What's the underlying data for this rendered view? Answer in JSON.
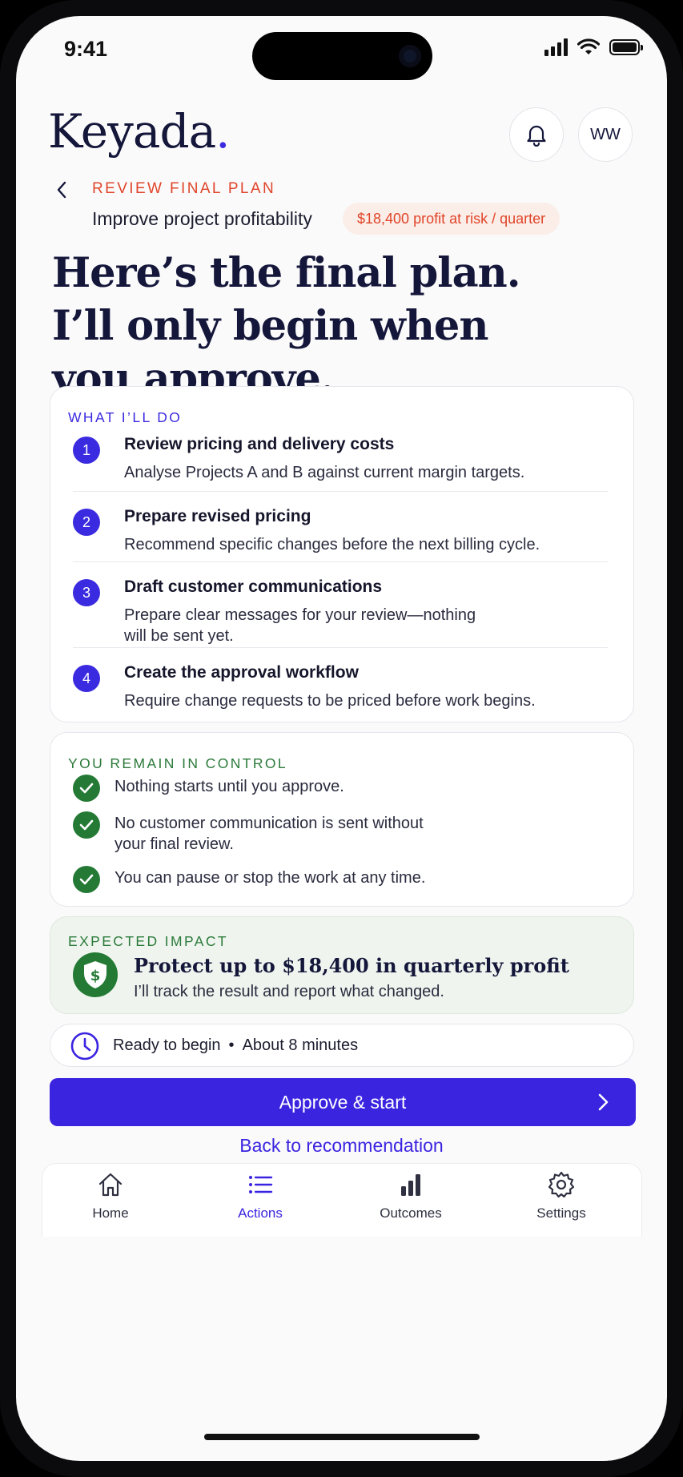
{
  "status": {
    "time": "9:41"
  },
  "header": {
    "brand": "Keyada",
    "brand_dot": ".",
    "avatar_initials": "WW"
  },
  "breadcrumb": {
    "label": "REVIEW FINAL PLAN",
    "subtitle": "Improve project profitability",
    "risk_badge": "$18,400 profit at risk / quarter"
  },
  "headline": {
    "line1": "Here’s the final plan.",
    "line2": "I’ll only begin when",
    "line3": "you approve."
  },
  "plan": {
    "label": "WHAT I’LL DO",
    "steps": [
      {
        "num": "1",
        "title": "Review pricing and delivery costs",
        "desc": "Analyse Projects A and B against current margin targets."
      },
      {
        "num": "2",
        "title": "Prepare revised pricing",
        "desc": "Recommend specific changes before the next billing cycle."
      },
      {
        "num": "3",
        "title": "Draft customer communications",
        "desc": "Prepare clear messages for your review—nothing will be sent yet."
      },
      {
        "num": "4",
        "title": "Create the approval workflow",
        "desc": "Require change requests to be priced before work begins."
      }
    ]
  },
  "control": {
    "label": "YOU REMAIN IN CONTROL",
    "items": [
      "Nothing starts until you approve.",
      "No customer communication is sent without your final review.",
      "You can pause or stop the work at any time."
    ]
  },
  "impact": {
    "label": "EXPECTED IMPACT",
    "title": "Protect up to $18,400 in quarterly profit",
    "sub": "I’ll track the result and report what changed."
  },
  "ready": {
    "status": "Ready to begin",
    "separator": "•",
    "duration": "About 8 minutes"
  },
  "actions": {
    "approve_label": "Approve & start",
    "back_label": "Back to recommendation"
  },
  "nav": {
    "items": [
      {
        "label": "Home",
        "icon": "home-icon",
        "active": false
      },
      {
        "label": "Actions",
        "icon": "list-icon",
        "active": true
      },
      {
        "label": "Outcomes",
        "icon": "bar-chart-icon",
        "active": false
      },
      {
        "label": "Settings",
        "icon": "gear-icon",
        "active": false
      }
    ]
  },
  "colors": {
    "accent": "#3b24e0",
    "risk": "#e0452a",
    "success": "#247a35"
  }
}
